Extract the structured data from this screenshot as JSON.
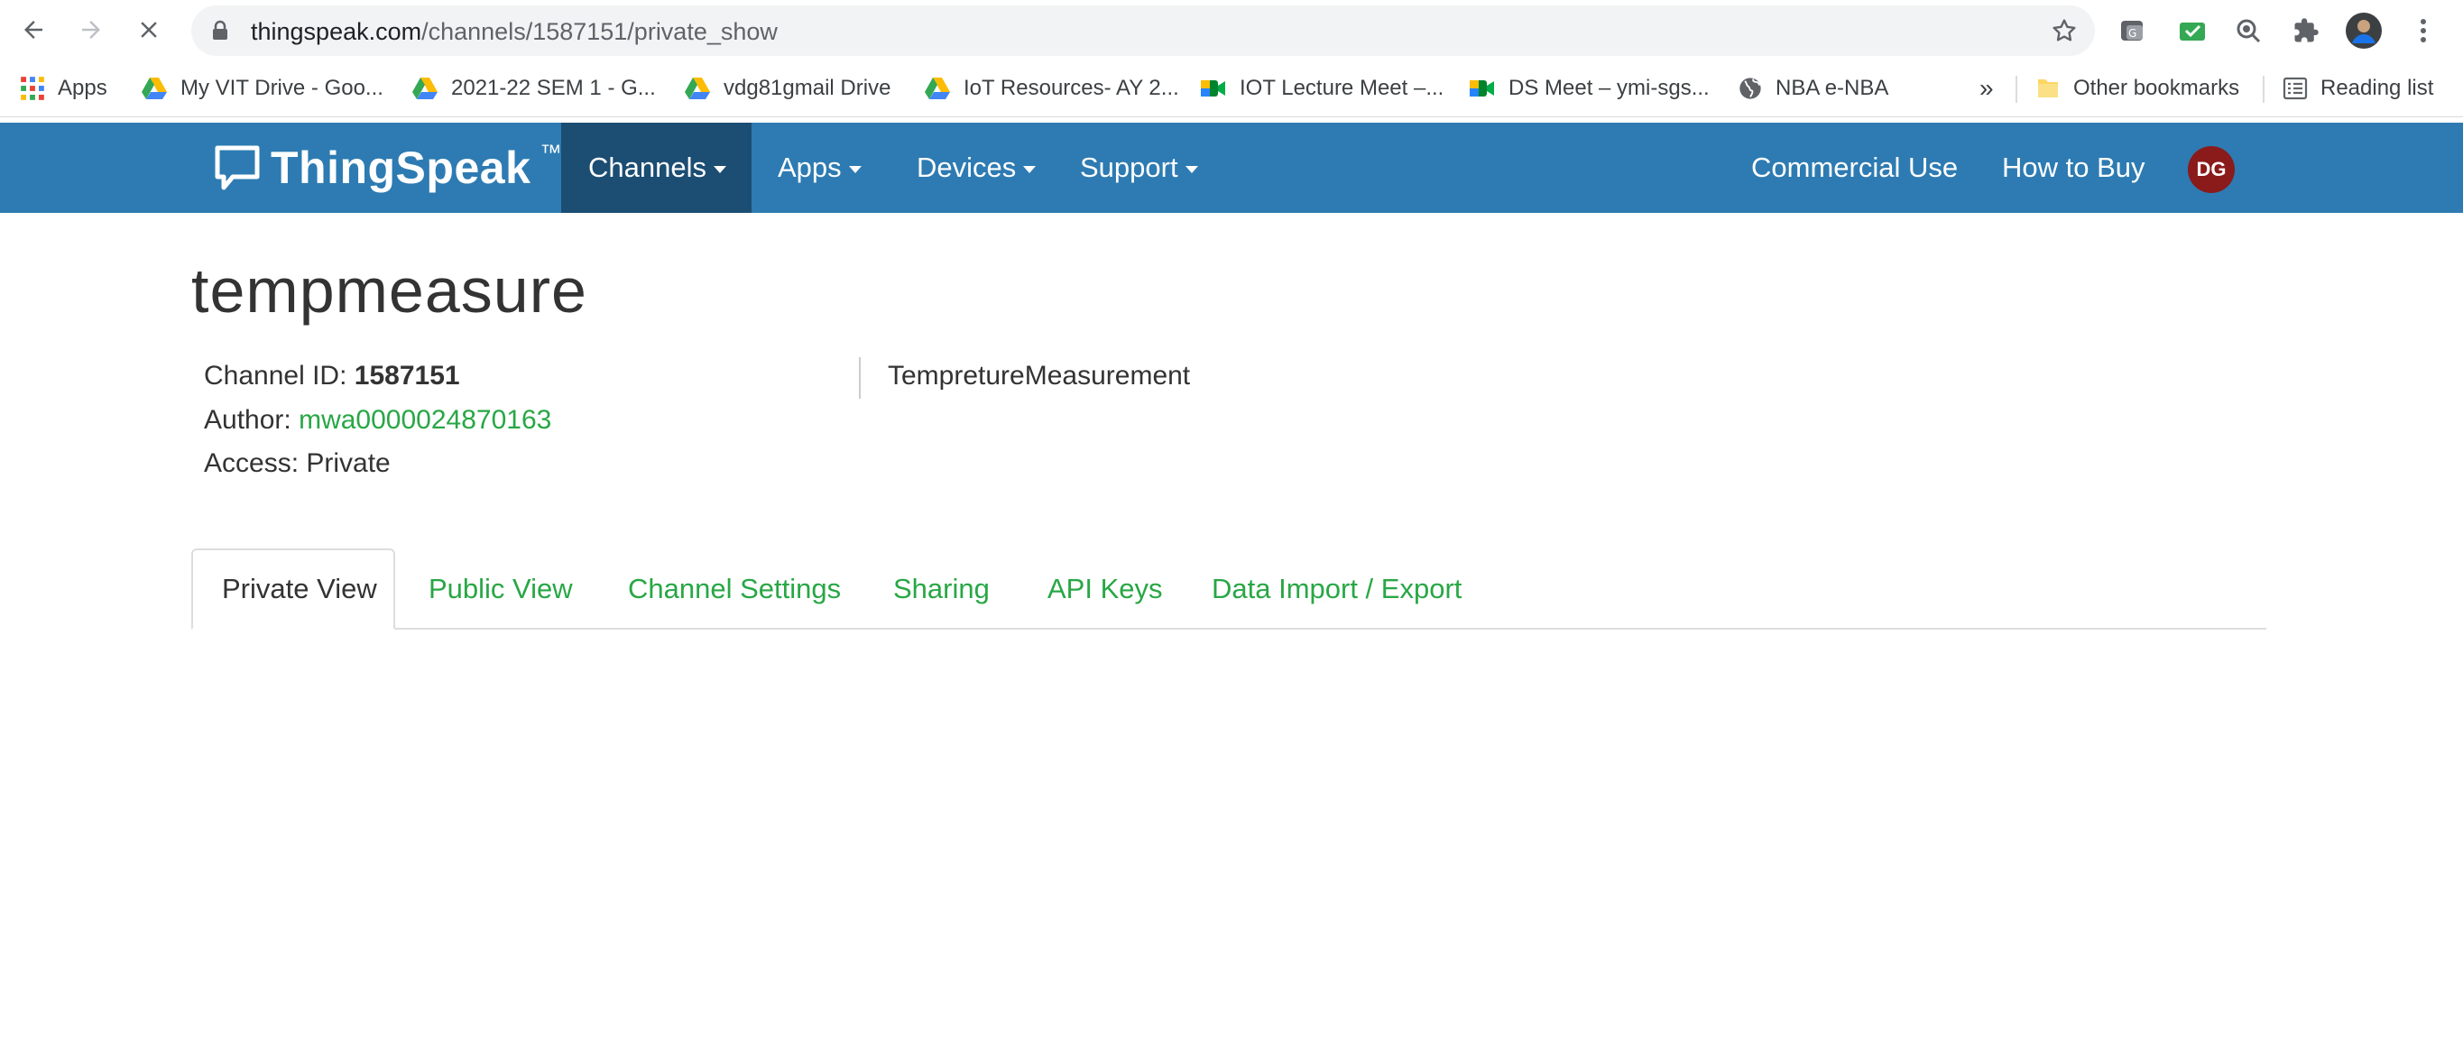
{
  "browser": {
    "url_host": "thingspeak.com",
    "url_path": "/channels/1587151/private_show",
    "bookmarks": [
      {
        "label": "Apps",
        "icon": "apps-grid-icon"
      },
      {
        "label": "My VIT Drive - Goo...",
        "icon": "google-drive-icon"
      },
      {
        "label": "2021-22 SEM 1 - G...",
        "icon": "google-drive-icon"
      },
      {
        "label": "vdg81gmail Drive",
        "icon": "google-drive-icon"
      },
      {
        "label": "IoT Resources- AY 2...",
        "icon": "google-drive-icon"
      },
      {
        "label": "IOT Lecture Meet –...",
        "icon": "google-meet-icon"
      },
      {
        "label": "DS Meet – ymi-sgs...",
        "icon": "google-meet-icon"
      },
      {
        "label": "NBA e-NBA",
        "icon": "globe-icon"
      }
    ],
    "overflow_label": "»",
    "other_bookmarks": "Other bookmarks",
    "reading_list": "Reading list"
  },
  "navbar": {
    "brand": "ThingSpeak",
    "brand_tm": "™",
    "items": [
      {
        "label": "Channels",
        "active": true
      },
      {
        "label": "Apps"
      },
      {
        "label": "Devices"
      },
      {
        "label": "Support"
      }
    ],
    "right": [
      {
        "label": "Commercial Use"
      },
      {
        "label": "How to Buy"
      }
    ],
    "avatar_initials": "DG"
  },
  "channel": {
    "title": "tempmeasure",
    "id_label": "Channel ID:",
    "id_value": "1587151",
    "author_label": "Author:",
    "author_value": "mwa0000024870163",
    "access_label": "Access:",
    "access_value": "Private",
    "description": "TempretureMeasurement"
  },
  "tabs": [
    {
      "label": "Private View",
      "active": true
    },
    {
      "label": "Public View"
    },
    {
      "label": "Channel Settings"
    },
    {
      "label": "Sharing"
    },
    {
      "label": "API Keys"
    },
    {
      "label": "Data Import / Export"
    }
  ],
  "colors": {
    "navbar": "#2d7bb2",
    "navbar_active": "#1c4d73",
    "link_green": "#28a745",
    "avatar": "#8b1a1a"
  }
}
